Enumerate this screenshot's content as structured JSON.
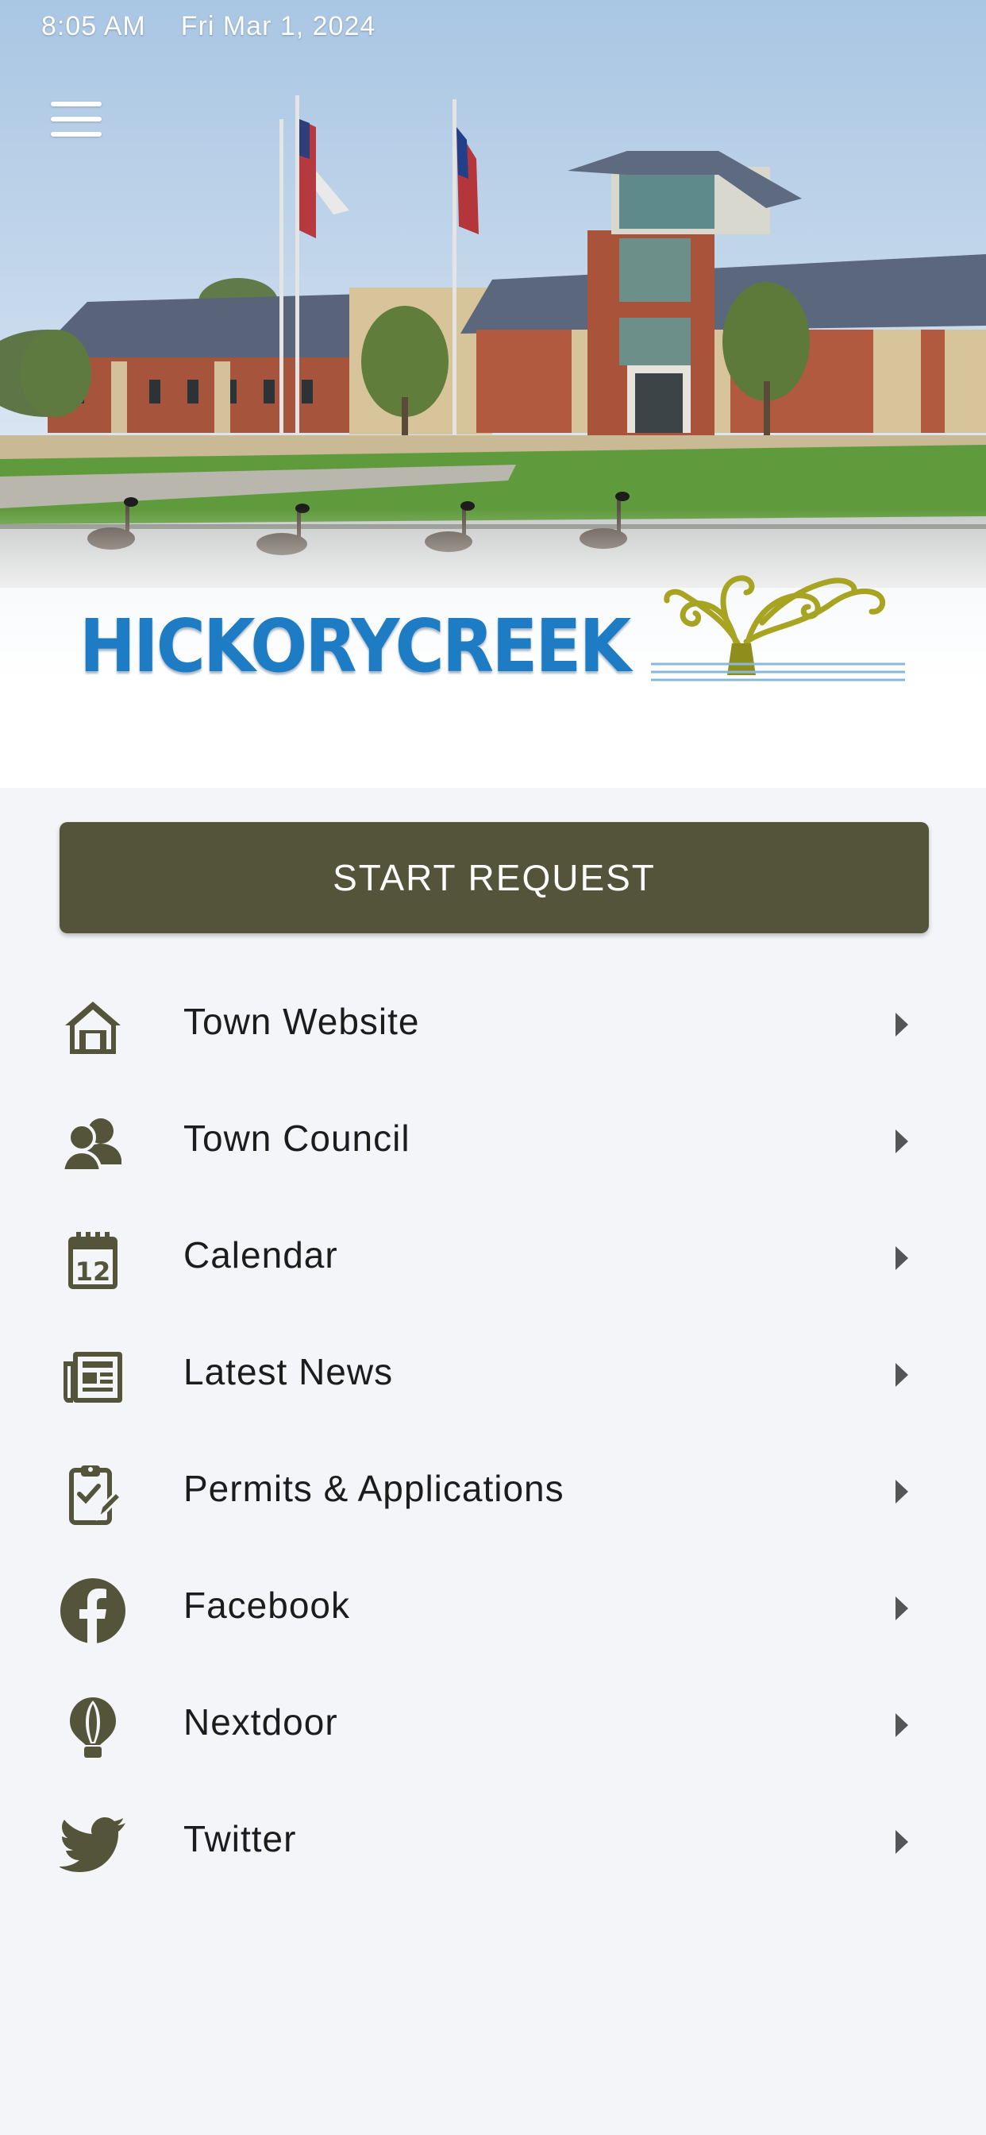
{
  "status_bar": {
    "time": "8:05 AM",
    "date": "Fri Mar 1, 2024"
  },
  "header": {
    "logo_text": "HICKORYCREEK",
    "menu_icon": "hamburger-icon"
  },
  "start_request": {
    "label": "START REQUEST"
  },
  "menu": [
    {
      "label": "Town Website",
      "icon": "home-icon"
    },
    {
      "label": "Town Council",
      "icon": "people-icon"
    },
    {
      "label": "Calendar",
      "icon": "calendar-icon"
    },
    {
      "label": "Latest News",
      "icon": "newspaper-icon"
    },
    {
      "label": "Permits & Applications",
      "icon": "clipboard-icon"
    },
    {
      "label": "Facebook",
      "icon": "facebook-icon"
    },
    {
      "label": "Nextdoor",
      "icon": "nextdoor-icon"
    },
    {
      "label": "Twitter",
      "icon": "twitter-icon"
    }
  ],
  "colors": {
    "accent": "#53543a",
    "icon": "#53543a",
    "logo_blue": "#1d7cc4",
    "logo_tree": "#a6a421",
    "background": "#f4f5f8"
  }
}
